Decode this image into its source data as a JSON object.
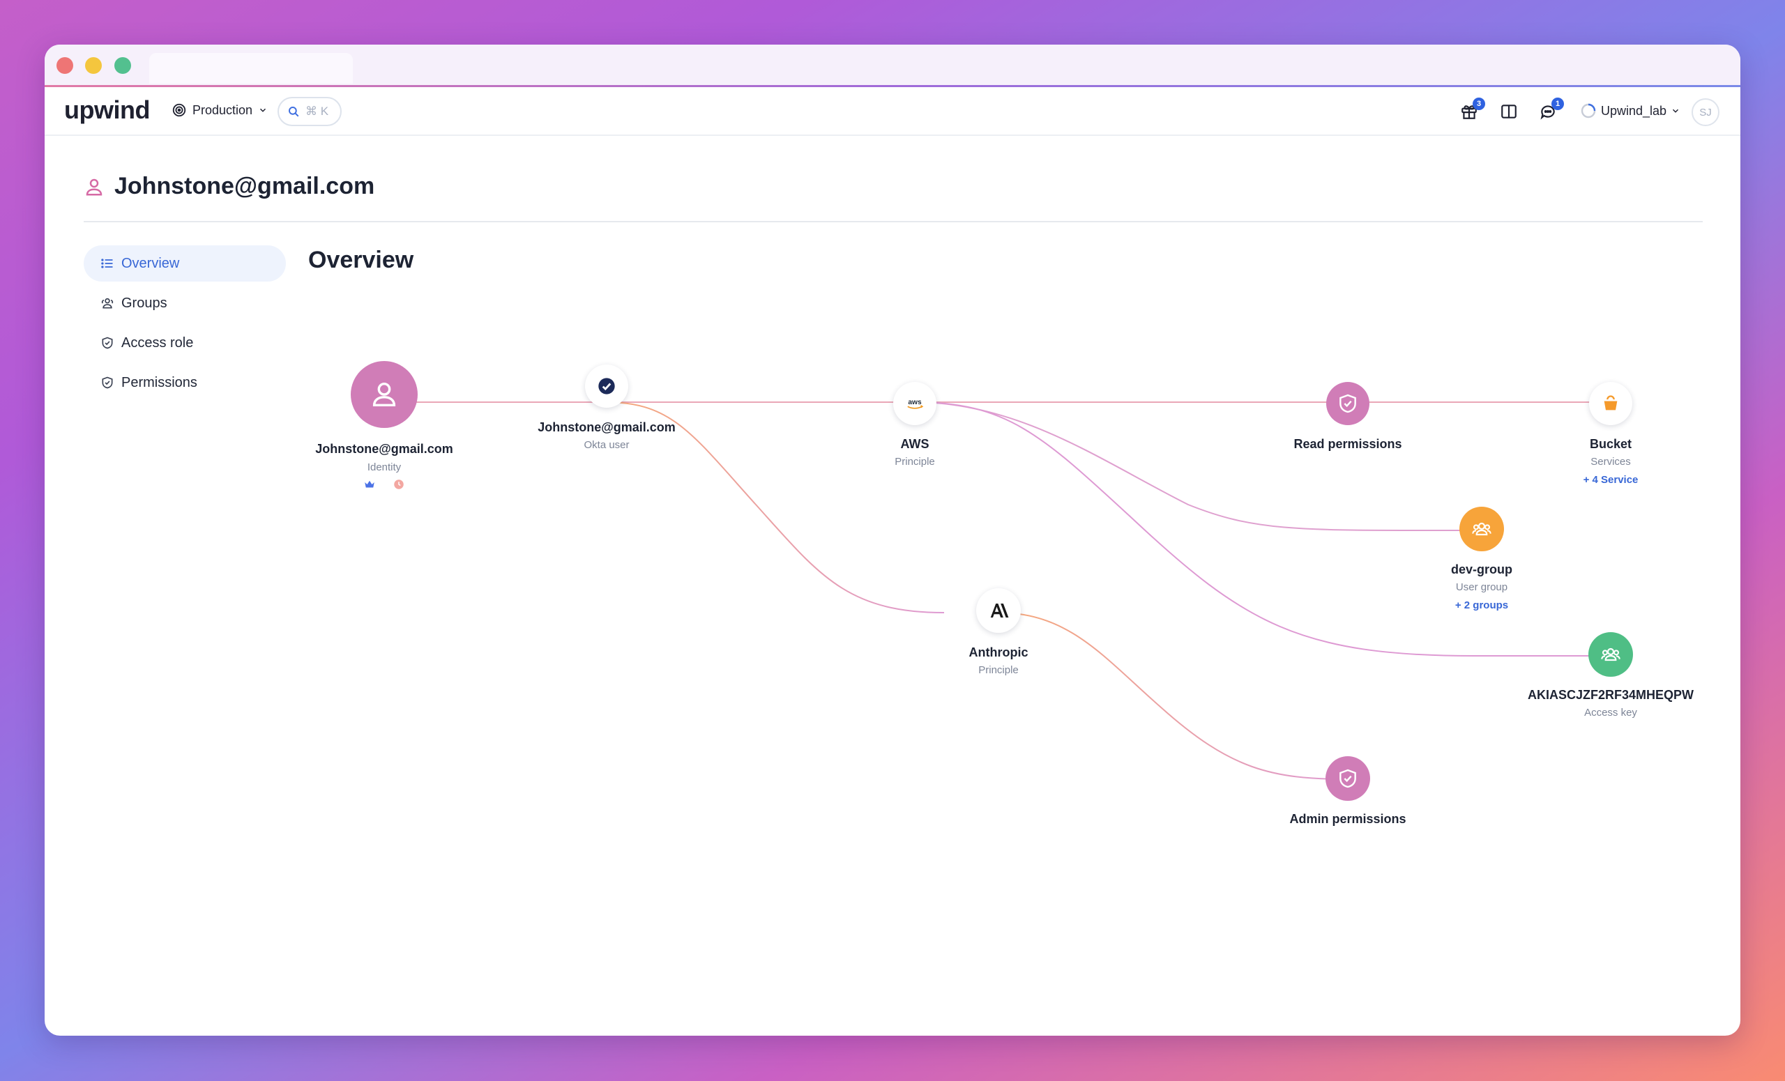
{
  "app": {
    "logo": "upwind",
    "environment": "Production",
    "search_hint": "⌘ K",
    "gift_badge": "3",
    "chat_badge": "1",
    "org": "Upwind_lab",
    "avatar": "SJ"
  },
  "page": {
    "title": "Johnstone@gmail.com",
    "section_title": "Overview"
  },
  "sidebar": {
    "items": [
      {
        "label": "Overview",
        "icon": "list-icon",
        "active": true
      },
      {
        "label": "Groups",
        "icon": "users-icon",
        "active": false
      },
      {
        "label": "Access role",
        "icon": "shield-icon",
        "active": false
      },
      {
        "label": "Permissions",
        "icon": "shield-icon",
        "active": false
      }
    ]
  },
  "graph": {
    "identity": {
      "label": "Johnstone@gmail.com",
      "sub": "Identity",
      "icon": "user-icon",
      "color": "#d07db7"
    },
    "okta": {
      "label": "Johnstone@gmail.com",
      "sub": "Okta user",
      "icon": "okta-check-icon"
    },
    "aws": {
      "label": "AWS",
      "sub": "Principle",
      "icon": "aws-logo-icon"
    },
    "anthropic": {
      "label": "Anthropic",
      "sub": "Principle",
      "icon": "anthropic-logo-icon"
    },
    "read_permissions": {
      "label": "Read permissions",
      "icon": "shield-check-icon",
      "color": "#d07db7"
    },
    "admin_permissions": {
      "label": "Admin permissions",
      "icon": "shield-check-icon",
      "color": "#d07db7"
    },
    "bucket": {
      "label": "Bucket",
      "sub": "Services",
      "more": "+ 4 Service",
      "icon": "bucket-icon",
      "color": "#f59a2b"
    },
    "dev_group": {
      "label": "dev-group",
      "sub": "User group",
      "more": "+ 2 groups",
      "icon": "group-icon",
      "color": "#f7a43a"
    },
    "access_key": {
      "label": "AKIASCJZF2RF34MHEQPW",
      "sub": "Access key",
      "icon": "group-icon",
      "color": "#4fbe85"
    }
  }
}
